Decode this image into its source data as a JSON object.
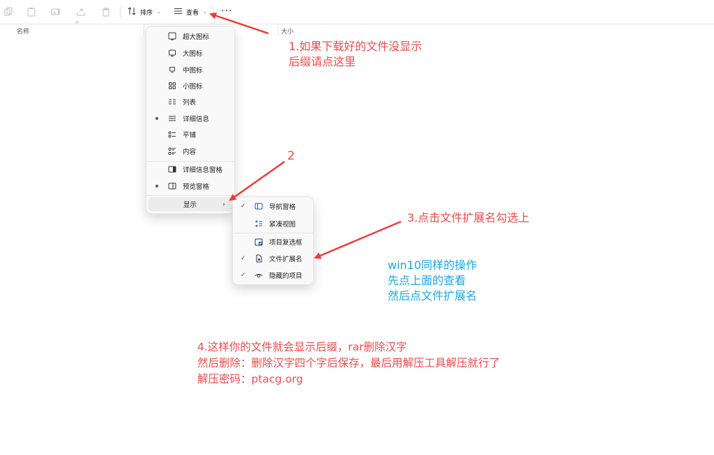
{
  "toolbar": {
    "sort_label": "排序",
    "view_label": "查看",
    "more_label": "···"
  },
  "header": {
    "col_name": "名称",
    "col_size": "大小"
  },
  "view_menu": {
    "items": [
      {
        "label": "超大图标",
        "icon": "monitor-xl-icon"
      },
      {
        "label": "大图标",
        "icon": "monitor-l-icon"
      },
      {
        "label": "中图标",
        "icon": "monitor-m-icon"
      },
      {
        "label": "小图标",
        "icon": "grid-small-icon"
      },
      {
        "label": "列表",
        "icon": "list-icon"
      },
      {
        "label": "详细信息",
        "icon": "details-icon"
      },
      {
        "label": "平铺",
        "icon": "tiles-icon"
      },
      {
        "label": "内容",
        "icon": "content-icon"
      }
    ],
    "panes": [
      {
        "label": "详细信息窗格",
        "icon": "details-pane-icon"
      },
      {
        "label": "预览窗格",
        "icon": "preview-pane-icon"
      }
    ],
    "show_label": "显示",
    "show_chevron": "›"
  },
  "show_menu": {
    "items": [
      {
        "label": "导航窗格",
        "checked": true
      },
      {
        "label": "紧凑视图",
        "checked": false
      },
      {
        "label": "项目复选框",
        "checked": false
      },
      {
        "label": "文件扩展名",
        "checked": true
      },
      {
        "label": "隐藏的项目",
        "checked": true
      }
    ]
  },
  "annotations": {
    "step1_line1": "1.如果下载好的文件没显示",
    "step1_line2": "后缀请点这里",
    "step2": "2",
    "step3": "3.点击文件扩展名勾选上",
    "win10_line1": "win10同样的操作",
    "win10_line2": "先点上面的查看",
    "win10_line3": "然后点文件扩展名",
    "step4_line1": "4.这样你的文件就会显示后缀，rar删除汉字",
    "step4_line2": "然后删除：删除汉字四个字后保存，最后用解压工具解压就行了",
    "step4_line3": "解压密码：ptacg.org"
  },
  "colors": {
    "annotation_red": "#f04a4a",
    "annotation_blue": "#1aa8e8",
    "arrow_red": "#ee3a3a"
  }
}
